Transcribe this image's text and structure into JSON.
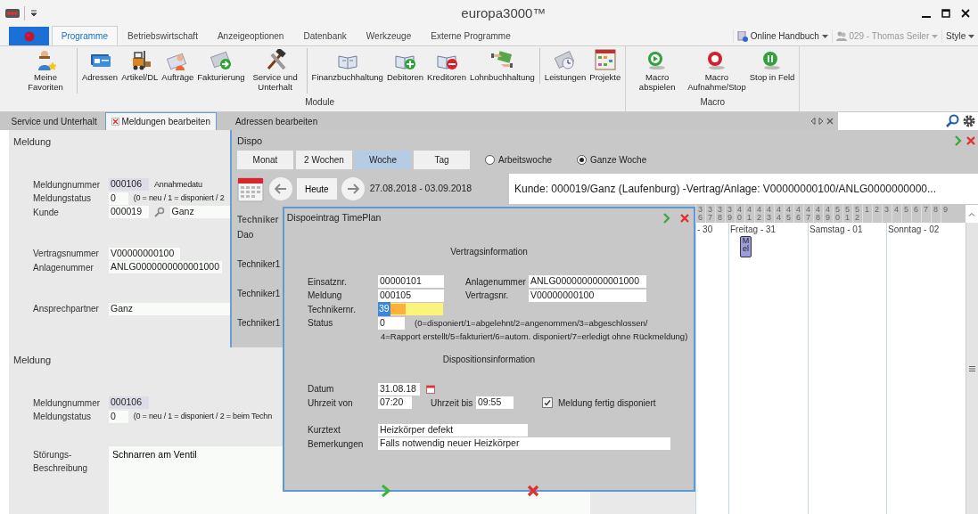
{
  "window": {
    "title": "europa3000™"
  },
  "ribbon_tabs": [
    {
      "label": "Programme",
      "selected": true
    },
    {
      "label": "Betriebswirtschaft",
      "selected": false
    },
    {
      "label": "Anzeigeoptionen",
      "selected": false
    },
    {
      "label": "Datenbank",
      "selected": false
    },
    {
      "label": "Werkzeuge",
      "selected": false
    },
    {
      "label": "Externe Programme",
      "selected": false
    }
  ],
  "quick_links": [
    {
      "label": "Online Handbuch",
      "disabled": false
    },
    {
      "label": "029 - Thomas Seiler",
      "disabled": true
    },
    {
      "label": "Style",
      "disabled": false
    }
  ],
  "ribbon_groups": [
    {
      "label": "Module",
      "items": [
        {
          "label": "Meine Favoriten",
          "separator_after": true
        },
        {
          "label": "Adressen",
          "separator_after": false
        },
        {
          "label": "Artikel/DL",
          "separator_after": false
        },
        {
          "label": "Aufträge",
          "separator_after": false
        },
        {
          "label": "Fakturierung",
          "separator_after": false
        },
        {
          "label": "Service und Unterhalt",
          "separator_after": true
        },
        {
          "label": "Finanzbuchhaltung",
          "separator_after": false
        },
        {
          "label": "Debitoren",
          "separator_after": false
        },
        {
          "label": "Kreditoren",
          "separator_after": false
        },
        {
          "label": "Lohnbuchhaltung",
          "separator_after": true
        },
        {
          "label": "Leistungen",
          "separator_after": false
        },
        {
          "label": "Projekte",
          "separator_after": false
        }
      ]
    },
    {
      "label": "Macro",
      "items": [
        {
          "label": "Macro abspielen",
          "separator_after": false
        },
        {
          "label": "Macro Aufnahme/Stop",
          "separator_after": false
        },
        {
          "label": "Stop in Feld",
          "separator_after": false
        }
      ]
    }
  ],
  "document_tabs": [
    {
      "label": "Service und Unterhalt",
      "selected": false,
      "closable": false
    },
    {
      "label": "Meldungen bearbeiten",
      "selected": true,
      "closable": true
    },
    {
      "label": "Adressen bearbeiten",
      "selected": false,
      "closable": false
    }
  ],
  "form_sections": [
    {
      "title": "Meldung",
      "groups": [
        [
          {
            "label": "Meldungnummer",
            "items": [
              {
                "kind": "readonly",
                "value": "000106"
              },
              {
                "kind": "note",
                "text": "Annahmedatu"
              }
            ]
          },
          {
            "label": "Meldungstatus",
            "items": [
              {
                "kind": "field",
                "value": "0"
              },
              {
                "kind": "note",
                "text": "(0 = neu / 1 = disponiert / 2"
              }
            ]
          },
          {
            "label": "Kunde",
            "items": [
              {
                "kind": "field",
                "value": "000019"
              },
              {
                "kind": "search"
              },
              {
                "kind": "wide",
                "value": "Ganz"
              }
            ]
          }
        ],
        [
          {
            "label": "Vertragsnummer",
            "items": [
              {
                "kind": "field",
                "value": "V00000000100"
              }
            ]
          },
          {
            "label": "Anlagenummer",
            "items": [
              {
                "kind": "field",
                "value": "ANLG0000000000001000"
              }
            ]
          }
        ],
        [
          {
            "label": "Ansprechpartner",
            "items": [
              {
                "kind": "wide",
                "value": "Ganz"
              }
            ]
          }
        ]
      ]
    },
    {
      "title": "Meldung",
      "groups": [
        [
          {
            "label": "Meldungnummer",
            "items": [
              {
                "kind": "readonly",
                "value": "000106"
              }
            ]
          },
          {
            "label": "Meldungstatus",
            "items": [
              {
                "kind": "field",
                "value": "0"
              },
              {
                "kind": "note",
                "text": "(0 = neu / 1 = disponiert / 2 = beim Techn"
              }
            ]
          }
        ],
        [
          {
            "label": "Störungs-Beschreibung",
            "items": [
              {
                "kind": "textarea",
                "value": "Schnarren am Ventil"
              }
            ]
          }
        ]
      ]
    }
  ],
  "dispo": {
    "title": "Dispo",
    "views": [
      {
        "label": "Monat",
        "selected": false
      },
      {
        "label": "2 Wochen",
        "selected": false
      },
      {
        "label": "Woche",
        "selected": true
      },
      {
        "label": "Tag",
        "selected": false
      }
    ],
    "week_modes": [
      {
        "label": "Arbeitswoche",
        "selected": false
      },
      {
        "label": "Ganze Woche",
        "selected": true
      }
    ],
    "today_button": "Heute",
    "date_range": "27.08.2018 - 03.09.2018",
    "info": "Kunde: 000019/Ganz (Laufenburg) -Vertrag/Anlage: V00000000100/ANLG0000000000...",
    "technician_header": "Techniker",
    "technicians": [
      "Dao",
      "Techniker1",
      "Techniker1",
      "Techniker1"
    ],
    "hours": [
      "36",
      "37",
      "38",
      "39",
      "40",
      "41",
      "42",
      "43",
      "44",
      "45",
      "46",
      "47",
      "48",
      "49",
      "50",
      "51",
      "52",
      "1",
      "2",
      "3",
      "4",
      "5",
      "6",
      "7",
      "8",
      "9"
    ],
    "days": [
      {
        "label": "- 30"
      },
      {
        "label": "Freitag - 31",
        "events": [
          "Mel"
        ]
      },
      {
        "label": "Samstag - 01"
      },
      {
        "label": "Sonntag - 02"
      }
    ]
  },
  "dialog": {
    "title": "Dispoeintrag TimePlan",
    "contract_heading": "Vertragsinformation",
    "contract_rows": [
      {
        "label": "Einsatznr.",
        "value": "00000101",
        "label_2": "Anlagenummer",
        "value_2": "ANLG0000000000001000"
      },
      {
        "label": "Meldung",
        "value": "000105",
        "label_2": "Vertragsnr.",
        "value_2": "V00000000100"
      }
    ],
    "technician": {
      "label": "Technikernr.",
      "value": "39",
      "focused": true
    },
    "status": {
      "label": "Status",
      "value": "0",
      "hint": "(0=disponiert/1=abgelehnt/2=angenommen/3=abgeschlossen/",
      "hint_2": "4=Rapport erstellt/5=fakturiert/6=autom. disponiert/7=erledigt ohne Rückmeldung)"
    },
    "disposition_heading": "Dispositionsinformation",
    "date": {
      "label": "Datum",
      "value": "31.08.18"
    },
    "time_from": {
      "label": "Uhrzeit von",
      "value": "07:20"
    },
    "time_to": {
      "label": "Uhrzeit bis",
      "value": "09:55"
    },
    "done": {
      "label": "Meldung fertig disponiert",
      "checked": true
    },
    "short_text": {
      "label": "Kurztext",
      "value": "Heizkörper defekt"
    },
    "remarks": {
      "label": "Bemerkungen",
      "value": "Falls notwendig neuer Heizkörper"
    }
  }
}
